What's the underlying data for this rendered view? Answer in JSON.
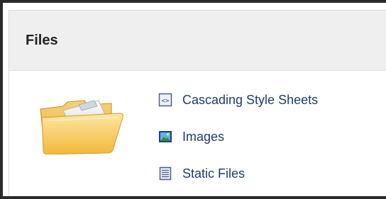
{
  "panel": {
    "title": "Files",
    "links": [
      {
        "label": "Cascading Style Sheets",
        "icon": "css-file-icon"
      },
      {
        "label": "Images",
        "icon": "image-icon"
      },
      {
        "label": "Static Files",
        "icon": "document-icon"
      }
    ]
  },
  "colors": {
    "header_bg": "#efefef",
    "link_text": "#1c3c6a",
    "frame_border": "#2a2a2a",
    "folder": "#f4c542"
  }
}
